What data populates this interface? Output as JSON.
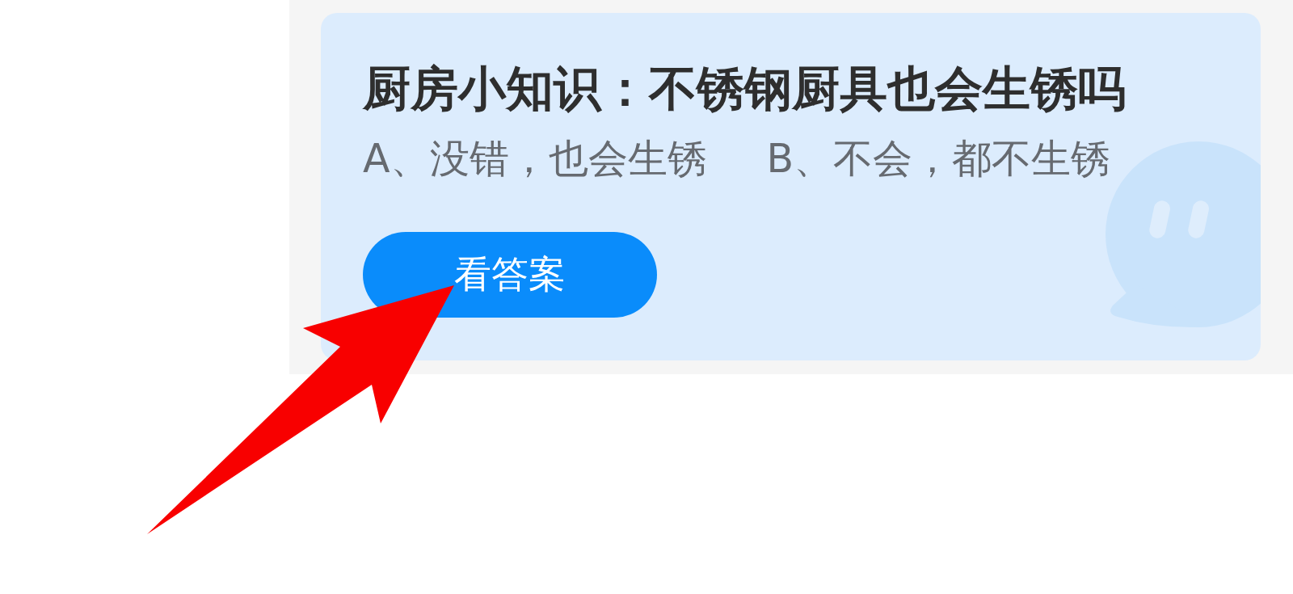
{
  "quiz_card": {
    "title": "厨房小知识：不锈钢厨具也会生锈吗",
    "options": [
      "A、没错，也会生锈",
      "B、不会，都不生锈"
    ],
    "button": {
      "label": "看答案"
    }
  }
}
